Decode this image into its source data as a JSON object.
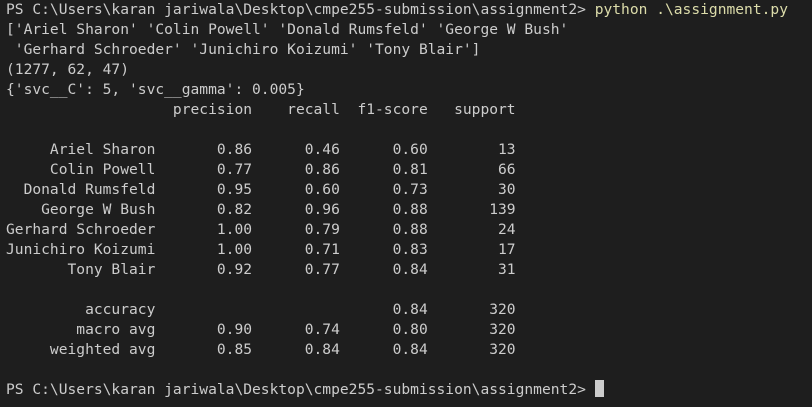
{
  "terminal": {
    "prompt_1": "PS C:\\Users\\karan jariwala\\Desktop\\cmpe255-submission\\assignment2> ",
    "command_1": "python .\\assignment.py",
    "output": [
      "['Ariel Sharon' 'Colin Powell' 'Donald Rumsfeld' 'George W Bush'",
      " 'Gerhard Schroeder' 'Junichiro Koizumi' 'Tony Blair']",
      "(1277, 62, 47)",
      "{'svc__C': 5, 'svc__gamma': 0.005}",
      "                   precision    recall  f1-score   support",
      "",
      "     Ariel Sharon       0.86      0.46      0.60        13",
      "     Colin Powell       0.77      0.86      0.81        66",
      "  Donald Rumsfeld       0.95      0.60      0.73        30",
      "    George W Bush       0.82      0.96      0.88       139",
      "Gerhard Schroeder       1.00      0.79      0.88        24",
      "Junichiro Koizumi       1.00      0.71      0.83        17",
      "       Tony Blair       0.92      0.77      0.84        31",
      "",
      "         accuracy                           0.84       320",
      "        macro avg       0.90      0.74      0.80       320",
      "     weighted avg       0.85      0.84      0.84       320",
      ""
    ],
    "prompt_2": "PS C:\\Users\\karan jariwala\\Desktop\\cmpe255-submission\\assignment2> ",
    "colors": {
      "background": "#1e1e1e",
      "text": "#cccccc",
      "command": "#dcdcaa"
    }
  }
}
